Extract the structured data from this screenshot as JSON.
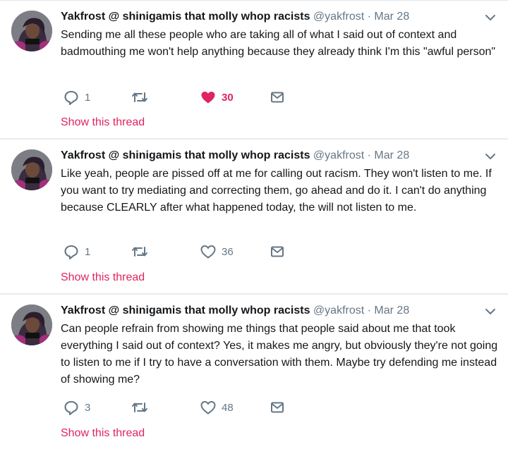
{
  "tweets": [
    {
      "name": "Yakfrost @ shinigamis that molly whop racists",
      "handle": "@yakfrost",
      "separator": "·",
      "time": "Mar 28",
      "text": "Sending me all these people who are taking all of what I said out of context and badmouthing me won't help anything because they already think I'm this \"awful person\"",
      "replies": "1",
      "retweets": "",
      "likes": "30",
      "liked": true,
      "thread_link": "Show this thread"
    },
    {
      "name": "Yakfrost @ shinigamis that molly whop racists",
      "handle": "@yakfrost",
      "separator": "·",
      "time": "Mar 28",
      "text": "Like yeah, people are pissed off at me for calling out racism. They won't listen to me. If you want to try mediating and correcting them, go ahead and do it. I can't do anything because CLEARLY after what happened today, the will not listen to me.",
      "replies": "1",
      "retweets": "",
      "likes": "36",
      "liked": false,
      "thread_link": "Show this thread"
    },
    {
      "name": "Yakfrost @ shinigamis that molly whop racists",
      "handle": "@yakfrost",
      "separator": "·",
      "time": "Mar 28",
      "text": "Can people refrain from showing me things that people said about me that took everything I said out of context? Yes, it makes me angry, but obviously they're not going to listen to me if I try to have a conversation with them. Maybe try defending me instead of showing me?",
      "replies": "3",
      "retweets": "",
      "likes": "48",
      "liked": false,
      "thread_link": "Show this thread"
    }
  ],
  "icons": {
    "reply": "reply-icon",
    "retweet": "retweet-icon",
    "like": "heart-icon",
    "message": "envelope-icon",
    "more": "chevron-down-icon"
  },
  "colors": {
    "background": "#e6ecf0",
    "text": "#14171a",
    "secondary": "#657786",
    "like_red": "#e0245e",
    "link": "#e0245e"
  }
}
